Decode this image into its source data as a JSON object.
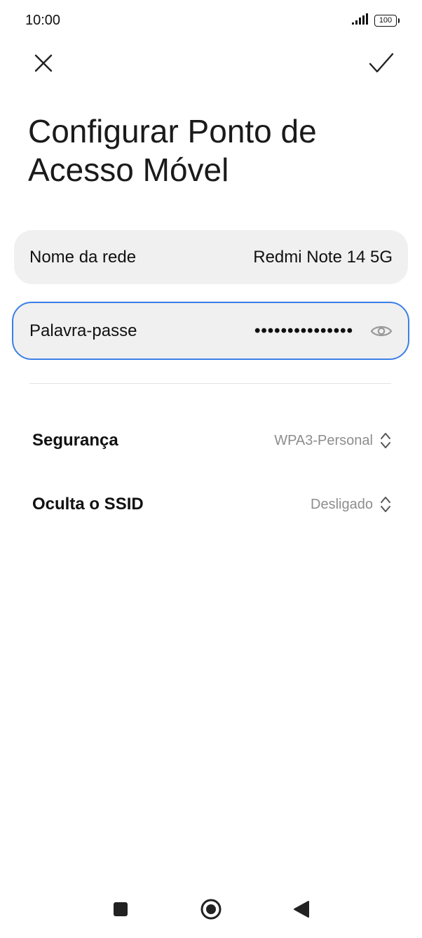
{
  "status_bar": {
    "time": "10:00",
    "battery": "100",
    "signal_icon": "signal-bars-icon"
  },
  "top_bar": {
    "close_icon": "close-icon",
    "confirm_icon": "checkmark-icon"
  },
  "title": "Configurar Ponto de Acesso Móvel",
  "fields": {
    "network_name": {
      "label": "Nome da rede",
      "value": "Redmi Note 14 5G"
    },
    "password": {
      "label": "Palavra-passe",
      "value": "•••••••••••••••",
      "toggle_icon": "eye-icon"
    }
  },
  "settings": {
    "security": {
      "label": "Segurança",
      "value": "WPA3-Personal",
      "icon": "chevron-updown-icon"
    },
    "hide_ssid": {
      "label": "Oculta o SSID",
      "value": "Desligado",
      "icon": "chevron-updown-icon"
    }
  },
  "accent_color": "#3c7fe6",
  "nav_bar": {
    "recent_icon": "square-recent-icon",
    "home_icon": "circle-home-icon",
    "back_icon": "triangle-back-icon"
  }
}
